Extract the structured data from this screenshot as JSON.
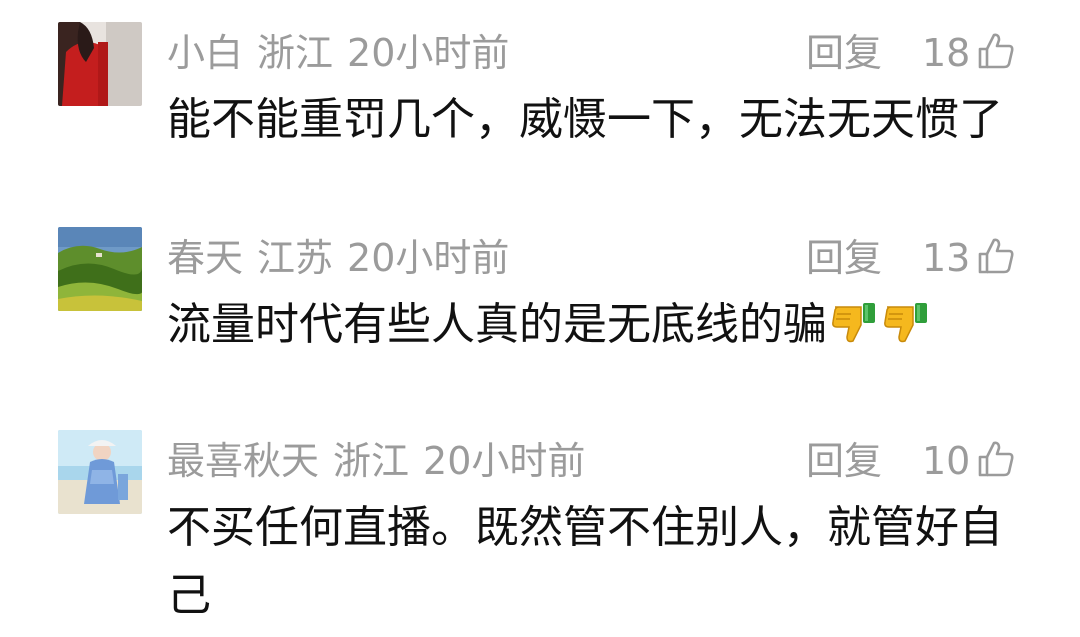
{
  "comments": [
    {
      "username": "小白",
      "location": "浙江",
      "time": "20小时前",
      "reply_label": "回复",
      "likes": "18",
      "text": "能不能重罚几个，威慑一下，无法无天惯了",
      "avatar": "avatar-person-red-jacket",
      "emojis": []
    },
    {
      "username": "春天",
      "location": "江苏",
      "time": "20小时前",
      "reply_label": "回复",
      "likes": "13",
      "text": "流量时代有些人真的是无底线的骗",
      "avatar": "avatar-green-hills-landscape",
      "emojis": [
        "thumbs-down-emoji",
        "thumbs-down-emoji"
      ]
    },
    {
      "username": "最喜秋天",
      "location": "浙江",
      "time": "20小时前",
      "reply_label": "回复",
      "likes": "10",
      "text": "不买任何直播。既然管不住别人，就管好自己",
      "avatar": "avatar-girl-beach",
      "emojis": []
    }
  ],
  "icons": {
    "like": "thumbs-up-outline-icon"
  }
}
